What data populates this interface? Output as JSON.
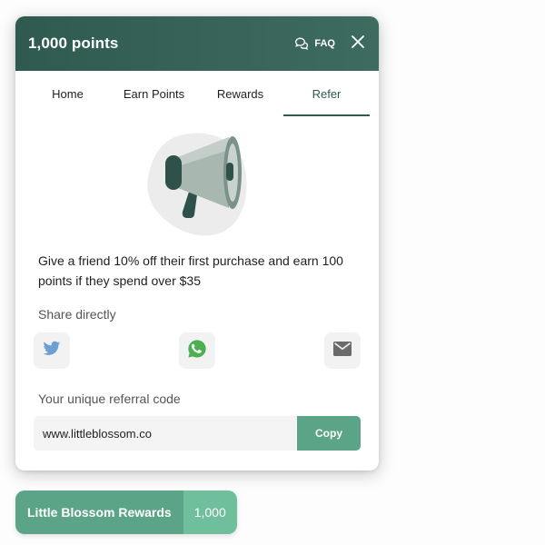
{
  "colors": {
    "header_bg": "#2f5a50",
    "accent": "#5ba487",
    "accent_light": "#6fbf9c",
    "twitter": "#6d9fd3",
    "whatsapp": "#4caf50",
    "email_icon": "#6b6b6b"
  },
  "header": {
    "title": "1,000 points",
    "faq_label": "FAQ",
    "faq_icon": "chat-bubbles-icon",
    "close_icon": "close-icon"
  },
  "tabs": [
    {
      "label": "Home",
      "active": false
    },
    {
      "label": "Earn Points",
      "active": false
    },
    {
      "label": "Rewards",
      "active": false
    },
    {
      "label": "Refer",
      "active": true
    }
  ],
  "refer": {
    "illustration_icon": "megaphone-icon",
    "description": "Give a friend 10% off their first purchase and earn 100 points if they spend over $35",
    "share_label": "Share directly",
    "share_buttons": [
      {
        "icon": "twitter-icon"
      },
      {
        "icon": "whatsapp-icon"
      },
      {
        "icon": "email-icon"
      }
    ],
    "code_label": "Your unique referral code",
    "code_value": "www.littleblossom.co",
    "copy_label": "Copy"
  },
  "launcher": {
    "label": "Little Blossom Rewards",
    "points": "1,000"
  }
}
